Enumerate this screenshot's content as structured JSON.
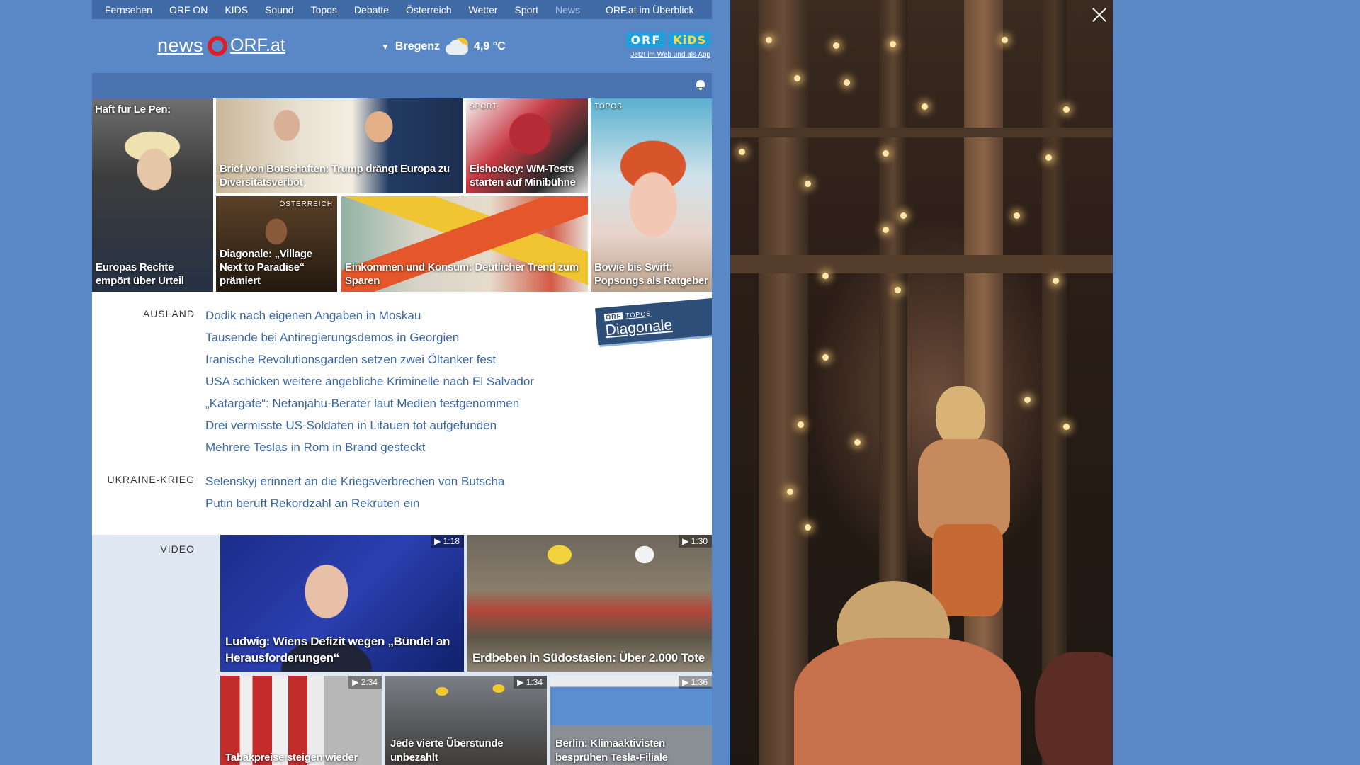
{
  "topnav": {
    "items": [
      "Fernsehen",
      "ORF ON",
      "KIDS",
      "Sound",
      "Topos",
      "Debatte",
      "Österreich",
      "Wetter",
      "Sport",
      "News"
    ],
    "overview": "ORF.at im Überblick"
  },
  "header": {
    "logo_news": "news",
    "logo_orf": "ORF.at",
    "location": "Bregenz",
    "temperature": "4,9 °C",
    "kids_badge_orf": "ORF",
    "kids_badge_kids": "KiDS",
    "kids_sub": "Jetzt im Web und als App"
  },
  "teasers": {
    "lepen_top": "Haft für Le Pen:",
    "lepen_cap": "Europas Rechte empört über Urteil",
    "trump_cap": "Brief von Botschaften: Trump drängt Europa zu Diversitätsverbot",
    "sport_kicker": "SPORT",
    "sport_cap": "Eishockey: WM-Tests starten auf Minibühne",
    "topos_kicker": "TOPOS",
    "bowie_cap": "Bowie bis Swift: Popsongs als Ratgeber",
    "oesterreich_kicker": "ÖSTERREICH",
    "diagonale_cap": "Diagonale: „Village Next to Paradise“ prämiert",
    "einkommen_cap": "Einkommen und Konsum: Deutlicher Trend zum Sparen"
  },
  "ausland": {
    "label": "AUSLAND",
    "items": [
      "Dodik nach eigenen Angaben in Moskau",
      "Tausende bei Antiregierungsdemos in Georgien",
      "Iranische Revolutionsgarden setzen zwei Öltanker fest",
      "USA schicken weitere angebliche Kriminelle nach El Salvador",
      "„Katargate“: Netanjahu-Berater laut Medien festgenommen",
      "Drei vermisste US-Soldaten in Litauen tot aufgefunden",
      "Mehrere Teslas in Rom in Brand gesteckt"
    ]
  },
  "ukraine": {
    "label": "UKRAINE-KRIEG",
    "items": [
      "Selenskyj erinnert an die Kriegsverbrechen von Butscha",
      "Putin beruft Rekordzahl an Rekruten ein"
    ]
  },
  "diagonale_badge": {
    "orf": "ORF",
    "topos": "TOPOS",
    "title": "Diagonale"
  },
  "video": {
    "label": "VIDEO",
    "items": [
      {
        "duration": "▶ 1:18",
        "caption": "Ludwig: Wiens Defizit wegen „Bündel an Herausforderungen“"
      },
      {
        "duration": "▶ 1:30",
        "caption": "Erdbeben in Südostasien: Über 2.000 Tote"
      },
      {
        "duration": "▶ 2:34",
        "caption": "Tabakpreise steigen wieder"
      },
      {
        "duration": "▶ 1:34",
        "caption": "Jede vierte Überstunde unbezahlt"
      },
      {
        "duration": "▶ 1:36",
        "caption": "Berlin: Klimaaktivisten besprühen Tesla-Filiale"
      }
    ]
  },
  "overlay": {
    "close_icon": "close-icon"
  },
  "colors": {
    "page_bg": "#5a88c6",
    "nav_bg": "#3f6aa6",
    "link": "#3b68a8",
    "orf_red": "#d8202a"
  }
}
